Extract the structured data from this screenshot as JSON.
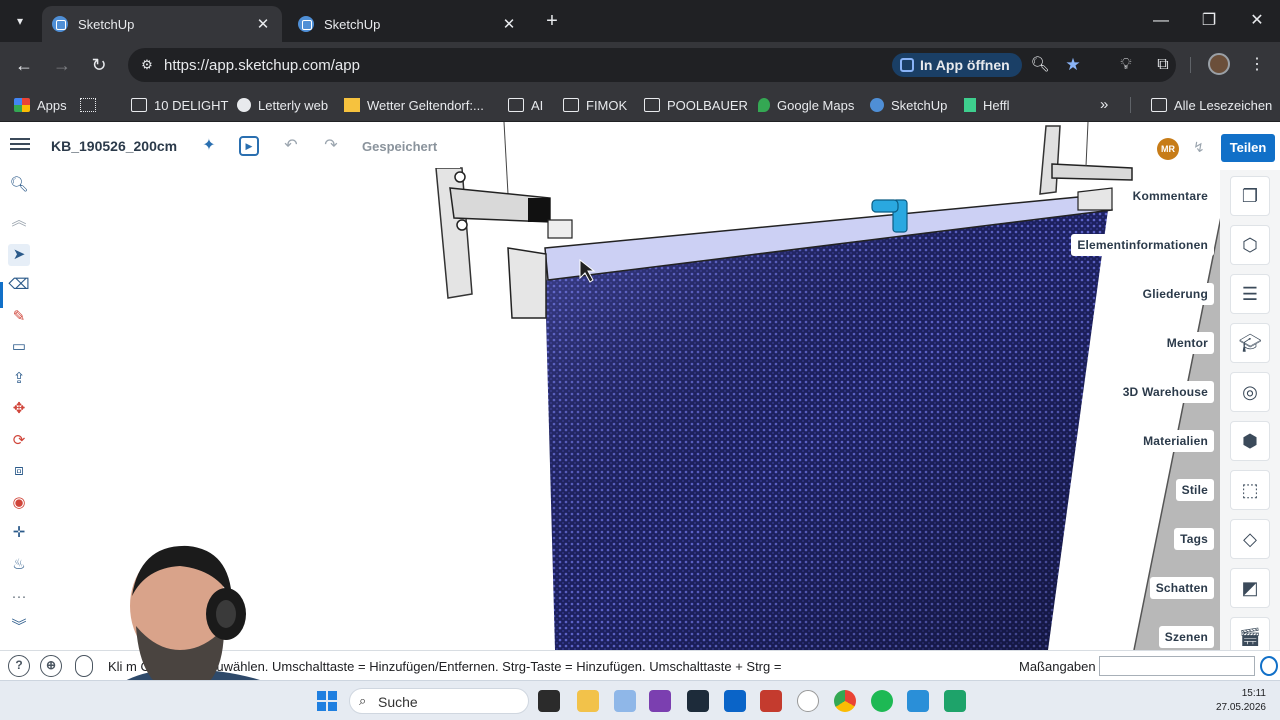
{
  "browser": {
    "tabs": [
      {
        "label": "SketchUp",
        "active": true
      },
      {
        "label": "SketchUp",
        "active": false
      }
    ],
    "url": "https://app.sketchup.com/app",
    "open_in_app": "In App öffnen",
    "bookmarks": [
      {
        "label": "Apps",
        "icon": "apps-grid-icon"
      },
      {
        "label": "10 DELIGHT",
        "icon": "folder-icon"
      },
      {
        "label": "Letterly web",
        "icon": "letterly-icon"
      },
      {
        "label": "Wetter Geltendorf:...",
        "icon": "weather-icon"
      },
      {
        "label": "AI",
        "icon": "folder-icon"
      },
      {
        "label": "FIMOK",
        "icon": "folder-icon"
      },
      {
        "label": "POOLBAUER",
        "icon": "folder-icon"
      },
      {
        "label": "Google Maps",
        "icon": "maps-icon"
      },
      {
        "label": "SketchUp",
        "icon": "sketchup-icon"
      },
      {
        "label": "Heffl",
        "icon": "heffl-icon"
      }
    ],
    "all_bookmarks": "Alle Lesezeichen"
  },
  "app": {
    "model_title": "KB_190526_200cm",
    "saved_status": "Gespeichert",
    "user_initials": "MR",
    "share_label": "Teilen",
    "panels": [
      {
        "label": "Kommentare",
        "icon": "comments-icon"
      },
      {
        "label": "Elementinformationen",
        "icon": "entity-info-icon"
      },
      {
        "label": "Gliederung",
        "icon": "outliner-icon"
      },
      {
        "label": "Mentor",
        "icon": "mentor-icon"
      },
      {
        "label": "3D Warehouse",
        "icon": "warehouse-icon"
      },
      {
        "label": "Materialien",
        "icon": "materials-icon"
      },
      {
        "label": "Stile",
        "icon": "styles-icon"
      },
      {
        "label": "Tags",
        "icon": "tags-icon"
      },
      {
        "label": "Schatten",
        "icon": "shadows-icon"
      },
      {
        "label": "Szenen",
        "icon": "scenes-icon"
      }
    ],
    "status_text": "Kli                 m Objekte auszuwählen. Umschalttaste = Hinzufügen/Entfernen. Strg-Taste = Hinzufügen. Umschalttaste + Strg =",
    "measurements_label": "Maßangaben",
    "measurements_value": ""
  },
  "taskbar": {
    "search_label": "Suche",
    "time": "15:11",
    "date": "27.05.2026"
  },
  "colors": {
    "accent": "#1170c8",
    "panel_texture": "#2a2f78"
  }
}
